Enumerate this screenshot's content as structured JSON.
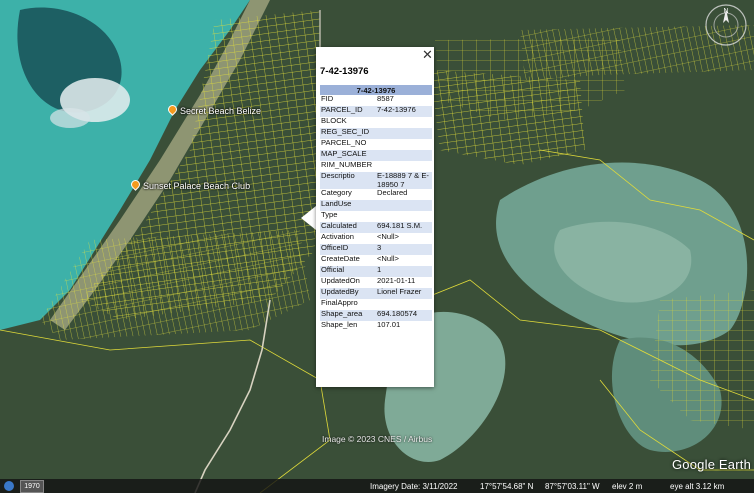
{
  "places": [
    {
      "name": "Secret Beach Belize"
    },
    {
      "name": "Sunset Palace Beach Club"
    }
  ],
  "popup": {
    "title": "7-42-13976",
    "table_header": "7-42-13976",
    "rows": [
      {
        "key": "FID",
        "value": "8587"
      },
      {
        "key": "PARCEL_ID",
        "value": "7-42-13976"
      },
      {
        "key": "BLOCK",
        "value": ""
      },
      {
        "key": "REG_SEC_ID",
        "value": ""
      },
      {
        "key": "PARCEL_NO",
        "value": ""
      },
      {
        "key": "MAP_SCALE",
        "value": ""
      },
      {
        "key": "RIM_NUMBER",
        "value": ""
      },
      {
        "key": "Descriptio",
        "value": "E-18889 7 & E-18950 7"
      },
      {
        "key": "Category",
        "value": "Declared"
      },
      {
        "key": "LandUse",
        "value": ""
      },
      {
        "key": "Type",
        "value": ""
      },
      {
        "key": "Calculated",
        "value": "694.181 S.M."
      },
      {
        "key": "Activation",
        "value": "<Null>"
      },
      {
        "key": "OfficeID",
        "value": "3"
      },
      {
        "key": "CreateDate",
        "value": "<Null>"
      },
      {
        "key": "Official",
        "value": "1"
      },
      {
        "key": "UpdatedOn",
        "value": "2021-01-11"
      },
      {
        "key": "UpdatedBy",
        "value": "Lionel Frazer"
      },
      {
        "key": "FinalAppro",
        "value": ""
      },
      {
        "key": "Shape_area",
        "value": "694.180574"
      },
      {
        "key": "Shape_len",
        "value": "107.01"
      }
    ]
  },
  "credit": "Image © 2023 CNES / Airbus",
  "logo": "Google Earth",
  "compass_letter": "N",
  "status": {
    "year": "1970",
    "imagery_date": "Imagery Date: 3/11/2022",
    "lat": "17°57'54.68\" N",
    "lon": "87°57'03.11\" W",
    "elev": "elev   2 m",
    "eye_alt": "eye alt   3.12 km"
  },
  "colors": {
    "sea": "#3fb0a8",
    "land": "#2e4634",
    "parcel_lines": "#e8e23a",
    "popup_header": "#9bb0d8",
    "row_alt": "#dbe4f3"
  }
}
